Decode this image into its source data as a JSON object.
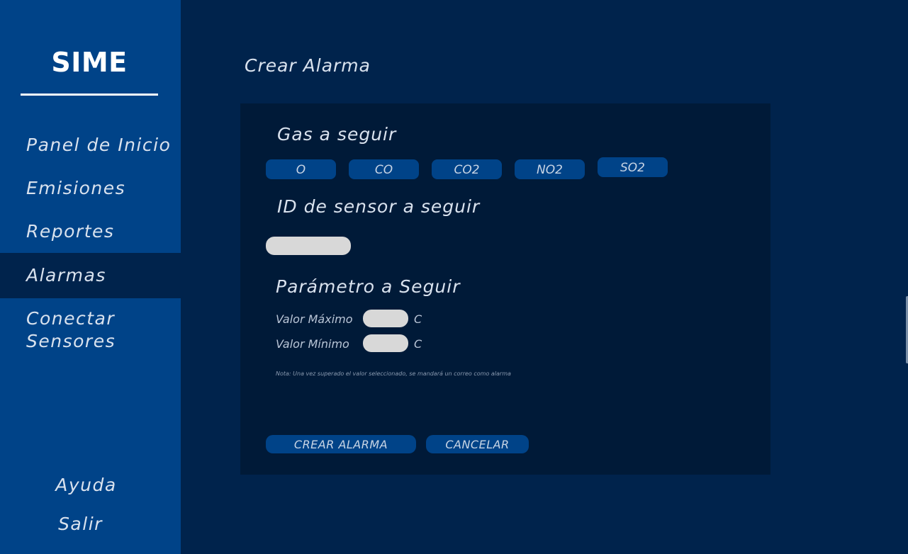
{
  "app": {
    "brand": "SIME"
  },
  "sidebar": {
    "items": [
      {
        "label": "Panel de Inicio",
        "active": false
      },
      {
        "label": "Emisiones",
        "active": false
      },
      {
        "label": "Reportes",
        "active": false
      },
      {
        "label": "Alarmas",
        "active": true
      },
      {
        "label": "Conectar Sensores",
        "active": false
      }
    ],
    "footer": [
      {
        "label": "Ayuda"
      },
      {
        "label": "Salir"
      }
    ]
  },
  "page": {
    "title": "Crear Alarma"
  },
  "form": {
    "gas_heading": "Gas a seguir",
    "gases": [
      "O",
      "CO",
      "CO2",
      "NO2",
      "SO2"
    ],
    "sensor_heading": "ID de sensor a seguir",
    "sensor_value": "",
    "param_heading": "Parámetro a Seguir",
    "max_label": "Valor Máximo",
    "max_value": "",
    "max_unit": "C",
    "min_label": "Valor Mínimo",
    "min_value": "",
    "min_unit": "C",
    "note": "Nota: Una vez superado el valor seleccionado, se mandará un correo como alarma",
    "create_label": "CREAR ALARMA",
    "cancel_label": "CANCELAR"
  },
  "colors": {
    "sidebar": "#004388",
    "background": "#00234c",
    "panel": "#001a38",
    "button": "#004388",
    "input": "#d8d8d8"
  }
}
